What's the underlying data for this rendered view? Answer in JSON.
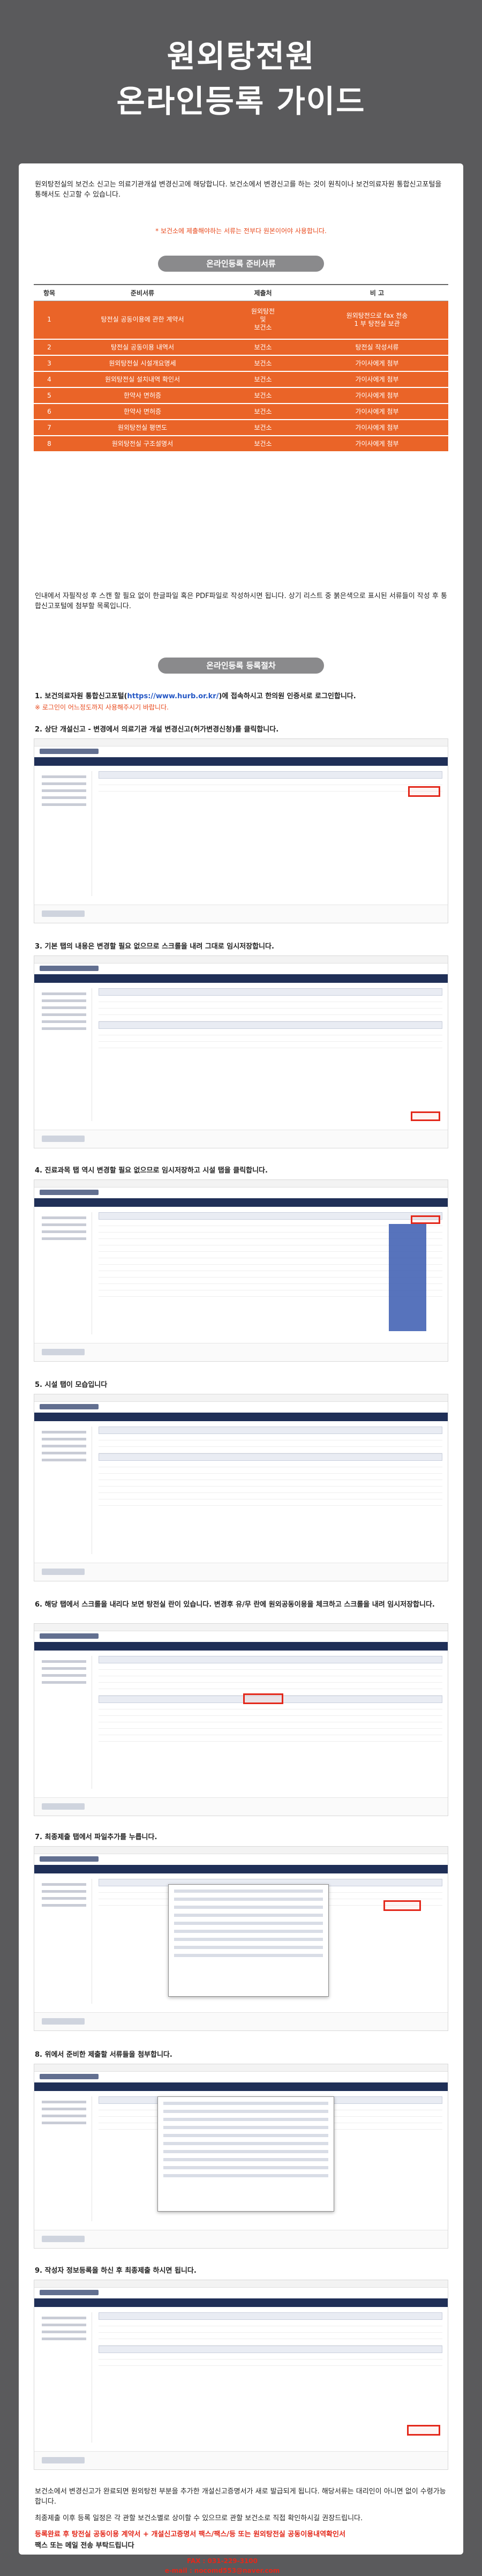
{
  "title_line1": "원외탕전원",
  "title_line2": "온라인등록 가이드",
  "intro": "원외탕전실의 보건소 신고는 의료기관개설 변경신고에 해당합니다. 보건소에서 변경신고를 하는 것이 원칙이나 보건의료자원 통합신고포털을 통해서도 신고할 수 있습니다.",
  "note": "* 보건소에 제출해야하는 서류는 전부다 원본이어야 사용합니다.",
  "docs_pill": "온라인등록 준비서류",
  "docs_table": {
    "headers": [
      "항목",
      "준비서류",
      "제출처",
      "비 고"
    ],
    "rows": [
      [
        "1",
        "탕전실 공동이용에 관한 계약서",
        "원외탕전\n및\n보건소",
        "원외탕전으로 fax 전송\n1 부 탕전실 보관"
      ],
      [
        "2",
        "탕전실 공동이용 내역서",
        "보건소",
        "탕전실 작성서류"
      ],
      [
        "3",
        "원외탕전실 시설개요명세",
        "보건소",
        "가이사에게 첨부"
      ],
      [
        "4",
        "원외탕전실 설치내역 확인서",
        "보건소",
        "가이사에게 첨부"
      ],
      [
        "5",
        "한약사 면허증",
        "보건소",
        "가이사에게 첨부"
      ],
      [
        "6",
        "한약사 면허증",
        "보건소",
        "가이사에게 첨부"
      ],
      [
        "7",
        "원외탕전실 평면도",
        "보건소",
        "가이사에게 첨부"
      ],
      [
        "8",
        "원외탕전실 구조설명서",
        "보건소",
        "가이사에게 첨부"
      ]
    ]
  },
  "after_table": "인내에서 자필작성 후 스캔 할 필요 없이 한글파일 혹은 PDF파일로 작성하시면 됩니다. 상기 리스트 중 붉은색으로 표시된 서류들이 작성 후 통합신고포털에 첨부할 목록입니다.",
  "steps_pill": "온라인등록 등록절차",
  "steps": [
    {
      "text_before": "1. 보건의료자원 통합신고포털(",
      "link": "https://www.hurb.or.kr/",
      "text_after": ")에 접속하시고 한의원 인증서로 로그인합니다.",
      "sub": "※ 로그인이 어느정도까지 사용해주시기 바랍니다."
    },
    {
      "text": "2. 상단 개설신고 - 변경에서 의료기관 개설 변경신고(허가변경신청)를 클릭합니다."
    },
    {
      "text": "3. 기본 탭의 내용은 변경할 필요 없으므로 스크롤을 내려 그대로 임시저장합니다."
    },
    {
      "text": "4. 진료과목 탭 역시 변경할 필요 없으므로 임시저장하고 시설 탭을 클릭합니다."
    },
    {
      "text": "5. 시설 탭이 모습입니다"
    },
    {
      "text": "6. 해당 탭에서 스크롤을 내리다 보면 탕전실 란이 있습니다. 변경후 유/무 란에 원외공동이용을 체크하고 스크롤을 내려 임시저장합니다."
    },
    {
      "text": "7. 최종제출 탭에서 파일추가를 누릅니다."
    },
    {
      "text": "8. 위에서 준비한 제출할 서류들을 첨부합니다."
    },
    {
      "text": "9. 작성자 정보등록을 하신 후 최종제출 하시면 됩니다."
    }
  ],
  "outro1": "보건소에서 변경신고가 완료되면 원외탕전 부분을 추가한 개설신고증명서가 새로 발급되게 됩니다. 해당서류는 대리인이 아니면 없이 수령가능합니다.",
  "outro2": "최종제출 이후 등록 일정은 각 관할 보건소별로 상이할 수 있으므로 관할 보건소로 직접 확인하시길 권장드립니다.",
  "outro3": "등록완료 후 탕전실 공동이용 계약서 + 개설신고증명서 팩스/팩스/등 또는 원외탕전실 공동이용내역확인서",
  "outro4": "팩스 또는 메일 전송 부탁드립니다",
  "contact_fax": "FAX : 031-229-3100",
  "contact_mail": "e-mail : nocomd553@naver.com",
  "colors": {
    "background": "#5a5a5c",
    "accent_orange": "#ea6428",
    "pill_gray": "#8a8a8c",
    "highlight_red": "#e3281b",
    "nav_navy": "#1f2f57"
  }
}
